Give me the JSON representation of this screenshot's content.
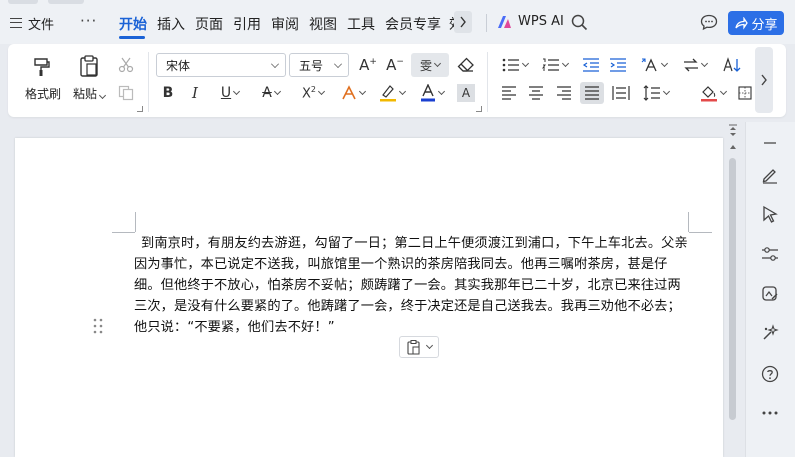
{
  "menubar": {
    "file_label": "文件",
    "more_label": "···",
    "tabs": [
      "开始",
      "插入",
      "页面",
      "引用",
      "审阅",
      "视图",
      "工具",
      "会员专享",
      "效"
    ],
    "active_tab": "开始",
    "ai_label": "WPS AI",
    "share_label": "分享"
  },
  "ribbon": {
    "format_painter_label": "格式刷",
    "paste_label": "粘贴",
    "font_name": "宋体",
    "font_size": "五号",
    "pinyin_glyph": "雯"
  },
  "document": {
    "paragraph": "到南京时，有朋友约去游逛，勾留了一日；第二日上午便须渡江到浦口，下午上车北去。父亲因为事忙，本已说定不送我，叫旅馆里一个熟识的茶房陪我同去。他再三嘱咐茶房，甚是仔细。但他终于不放心，怕茶房不妥帖；颇踌躇了一会。其实我那年已二十岁，北京已来往过两三次，是没有什么要紧的了。他踌躇了一会，终于决定还是自己送我去。我再三劝他不必去；他只说：“不要紧，他们去不好！”"
  },
  "colors": {
    "accent": "#1a62d6",
    "share_button": "#2c6fe6",
    "font_color_bar": "#1a3fd0",
    "highlight_bar": "#f2b800"
  }
}
